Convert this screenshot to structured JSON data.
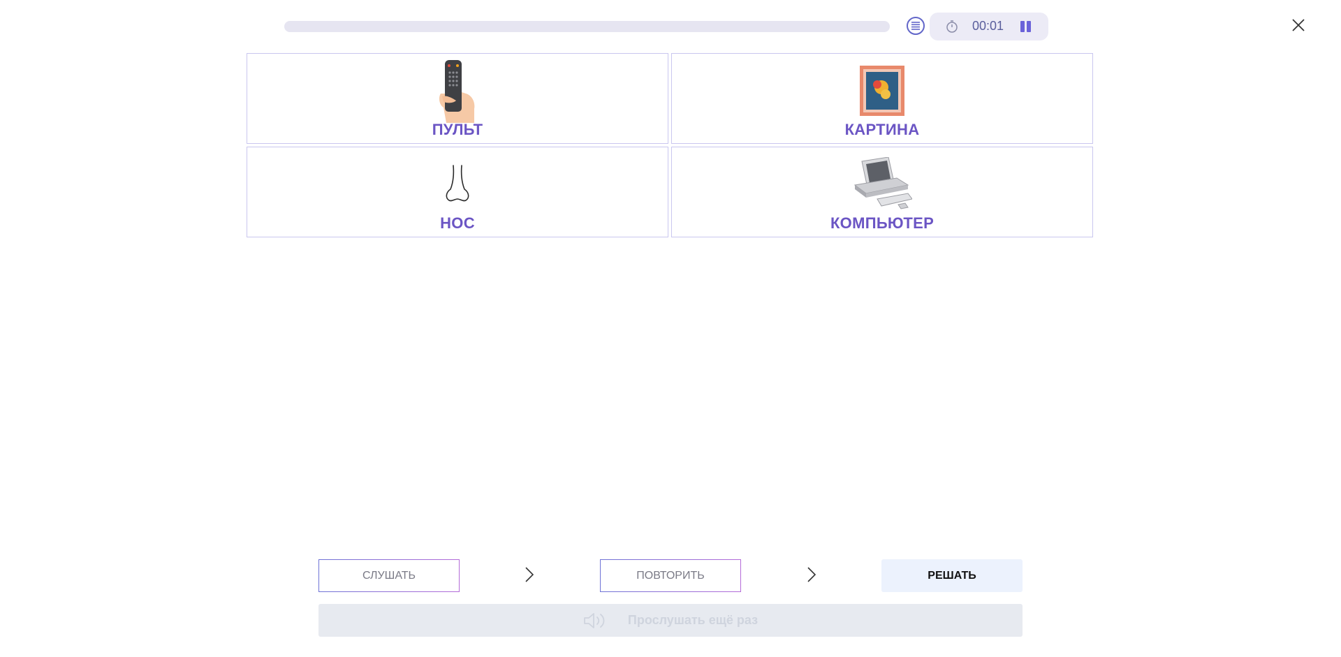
{
  "header": {
    "progress_fraction": 0,
    "timer": "00:01"
  },
  "cards": [
    {
      "label": "ПУЛЬТ",
      "icon": "remote-control-icon"
    },
    {
      "label": "КАРТИНА",
      "icon": "painting-icon"
    },
    {
      "label": "НОС",
      "icon": "nose-icon"
    },
    {
      "label": "КОМПЬЮТЕР",
      "icon": "computer-icon"
    }
  ],
  "controls": {
    "listen_label": "СЛУШАТЬ",
    "repeat_label": "ПОВТОРИТЬ",
    "solve_label": "РЕШАТЬ",
    "replay_label": "Прослушать ещё раз"
  },
  "colors": {
    "accent": "#6b55c4",
    "card_border": "#c9c6ef",
    "progress_track": "#e6e5f1"
  }
}
